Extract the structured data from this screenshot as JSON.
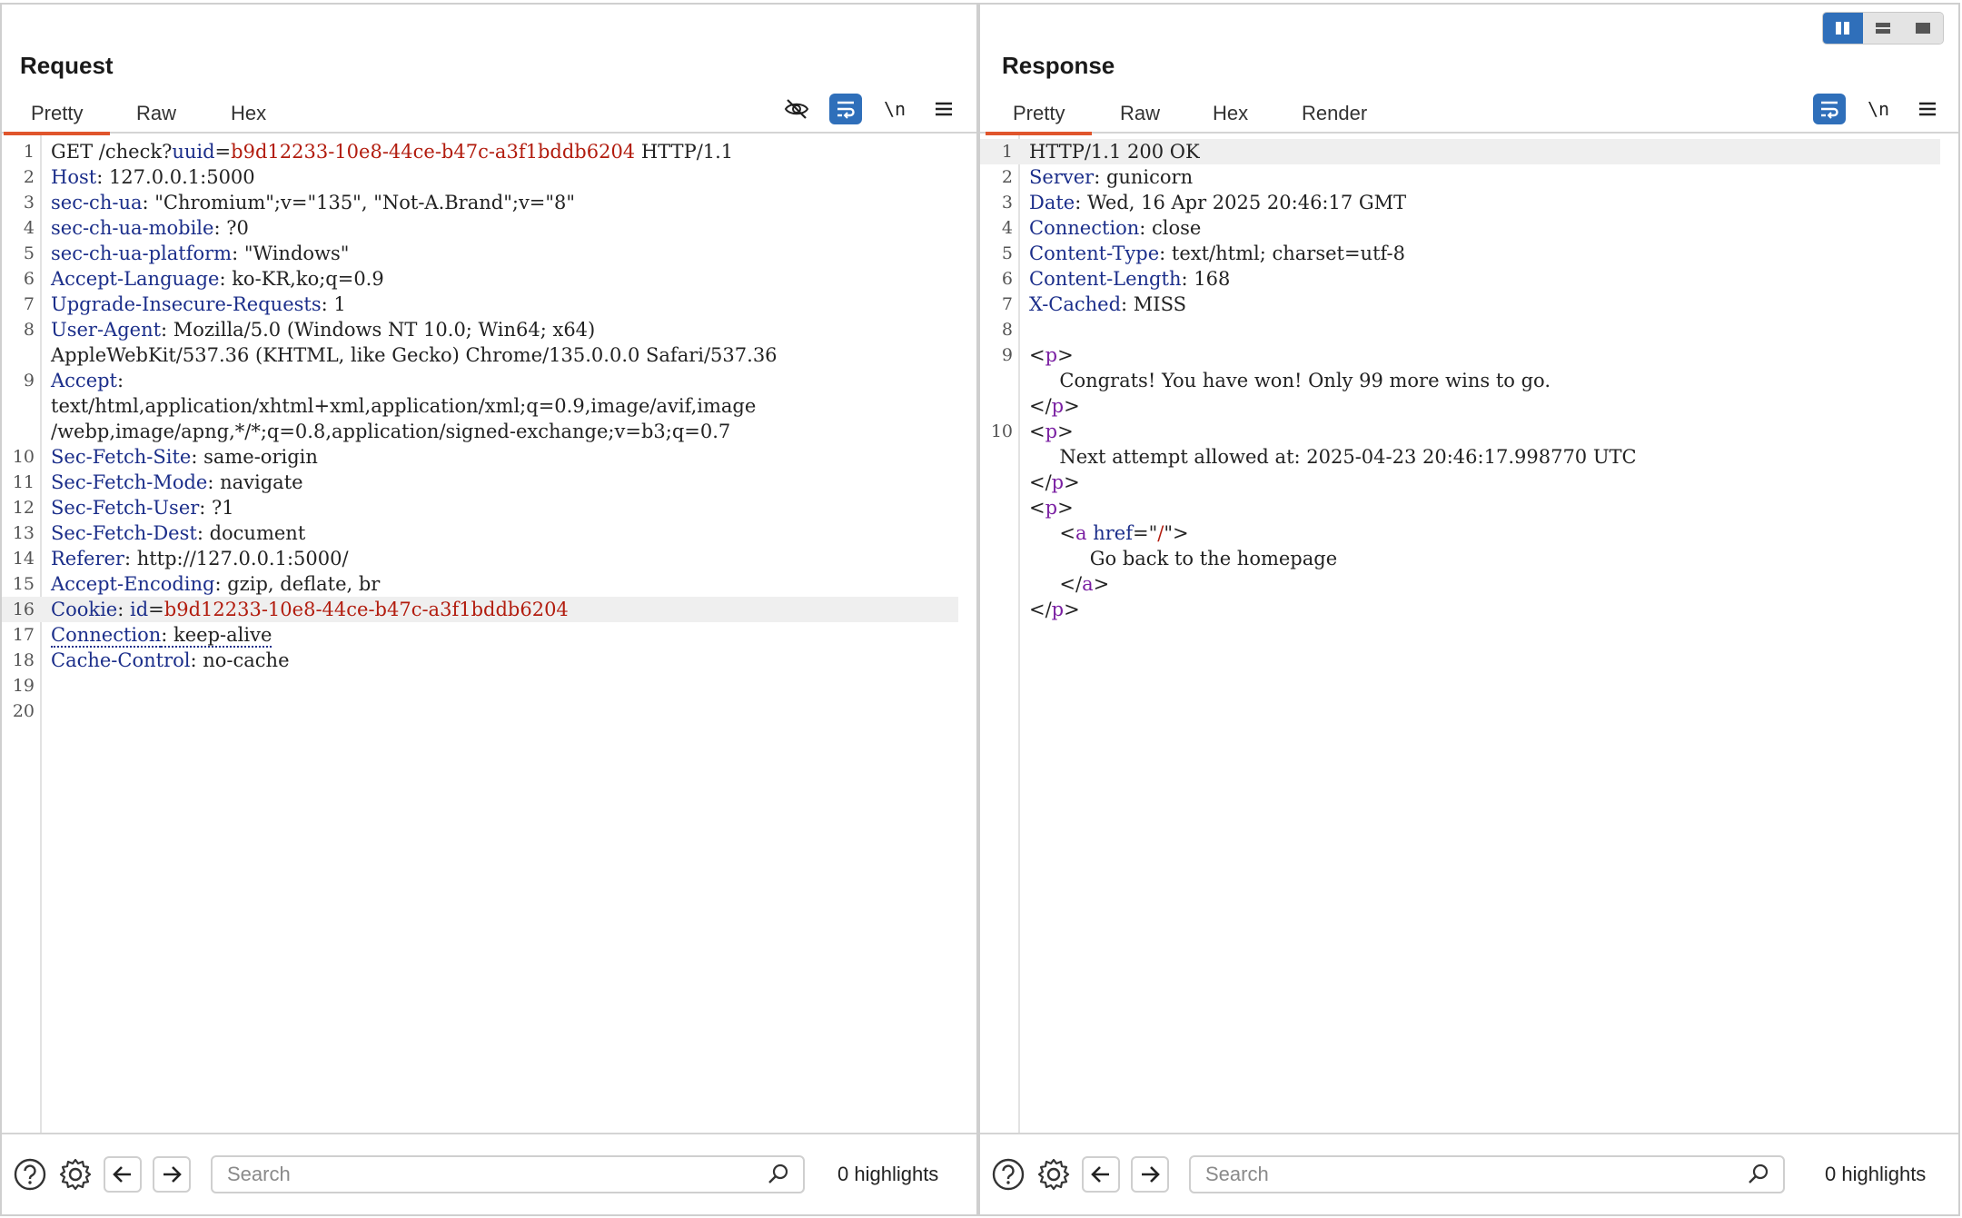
{
  "layout_toggle": [
    "side-by-side-icon",
    "stacked-icon",
    "single-icon"
  ],
  "request": {
    "title": "Request",
    "tabs": [
      "Pretty",
      "Raw",
      "Hex"
    ],
    "newline_label": "\\n",
    "lines": [
      {
        "n": "1",
        "parts": [
          [
            "v",
            "GET /check?"
          ],
          [
            "k",
            "uuid"
          ],
          [
            "v",
            "="
          ],
          [
            "r",
            "b9d12233-10e8-44ce-b47c-a3f1bddb6204"
          ],
          [
            "v",
            " HTTP/1.1"
          ]
        ]
      },
      {
        "n": "2",
        "parts": [
          [
            "k",
            "Host"
          ],
          [
            "v",
            ": 127.0.0.1:5000"
          ]
        ]
      },
      {
        "n": "3",
        "parts": [
          [
            "k",
            "sec-ch-ua"
          ],
          [
            "v",
            ": \"Chromium\";v=\"135\", \"Not-A.Brand\";v=\"8\""
          ]
        ]
      },
      {
        "n": "4",
        "parts": [
          [
            "k",
            "sec-ch-ua-mobile"
          ],
          [
            "v",
            ": ?0"
          ]
        ]
      },
      {
        "n": "5",
        "parts": [
          [
            "k",
            "sec-ch-ua-platform"
          ],
          [
            "v",
            ": \"Windows\""
          ]
        ]
      },
      {
        "n": "6",
        "parts": [
          [
            "k",
            "Accept-Language"
          ],
          [
            "v",
            ": ko-KR,ko;q=0.9"
          ]
        ]
      },
      {
        "n": "7",
        "parts": [
          [
            "k",
            "Upgrade-Insecure-Requests"
          ],
          [
            "v",
            ": 1"
          ]
        ]
      },
      {
        "n": "8",
        "parts": [
          [
            "k",
            "User-Agent"
          ],
          [
            "v",
            ": Mozilla/5.0 (Windows NT 10.0; Win64; x64)"
          ]
        ]
      },
      {
        "n": "",
        "parts": [
          [
            "v",
            "AppleWebKit/537.36 (KHTML, like Gecko) Chrome/135.0.0.0 Safari/537.36"
          ]
        ]
      },
      {
        "n": "9",
        "parts": [
          [
            "k",
            "Accept"
          ],
          [
            "v",
            ":"
          ]
        ]
      },
      {
        "n": "",
        "parts": [
          [
            "v",
            "text/html,application/xhtml+xml,application/xml;q=0.9,image/avif,image"
          ]
        ]
      },
      {
        "n": "",
        "parts": [
          [
            "v",
            "/webp,image/apng,*/*;q=0.8,application/signed-exchange;v=b3;q=0.7"
          ]
        ]
      },
      {
        "n": "10",
        "parts": [
          [
            "k",
            "Sec-Fetch-Site"
          ],
          [
            "v",
            ": same-origin"
          ]
        ]
      },
      {
        "n": "11",
        "parts": [
          [
            "k",
            "Sec-Fetch-Mode"
          ],
          [
            "v",
            ": navigate"
          ]
        ]
      },
      {
        "n": "12",
        "parts": [
          [
            "k",
            "Sec-Fetch-User"
          ],
          [
            "v",
            ": ?1"
          ]
        ]
      },
      {
        "n": "13",
        "parts": [
          [
            "k",
            "Sec-Fetch-Dest"
          ],
          [
            "v",
            ": document"
          ]
        ]
      },
      {
        "n": "14",
        "parts": [
          [
            "k",
            "Referer"
          ],
          [
            "v",
            ": http://127.0.0.1:5000/"
          ]
        ]
      },
      {
        "n": "15",
        "parts": [
          [
            "k",
            "Accept-Encoding"
          ],
          [
            "v",
            ": gzip, deflate, br"
          ]
        ]
      },
      {
        "n": "16",
        "hl": true,
        "parts": [
          [
            "k",
            "Cookie"
          ],
          [
            "v",
            ": "
          ],
          [
            "k",
            "id"
          ],
          [
            "v",
            "="
          ],
          [
            "r",
            "b9d12233-10e8-44ce-b47c-a3f1bddb6204"
          ]
        ]
      },
      {
        "n": "17",
        "parts": [
          [
            "kd",
            "Connection"
          ],
          [
            "vd",
            ": keep-alive"
          ]
        ]
      },
      {
        "n": "18",
        "parts": [
          [
            "k",
            "Cache-Control"
          ],
          [
            "v",
            ": no-cache"
          ]
        ]
      },
      {
        "n": "19",
        "parts": []
      },
      {
        "n": "20",
        "parts": []
      }
    ],
    "search_placeholder": "Search",
    "highlights": "0 highlights"
  },
  "response": {
    "title": "Response",
    "tabs": [
      "Pretty",
      "Raw",
      "Hex",
      "Render"
    ],
    "newline_label": "\\n",
    "lines": [
      {
        "n": "1",
        "hl": true,
        "parts": [
          [
            "v",
            "HTTP/1.1 200 OK"
          ]
        ]
      },
      {
        "n": "2",
        "parts": [
          [
            "k",
            "Server"
          ],
          [
            "v",
            ": gunicorn"
          ]
        ]
      },
      {
        "n": "3",
        "parts": [
          [
            "k",
            "Date"
          ],
          [
            "v",
            ": Wed, 16 Apr 2025 20:46:17 GMT"
          ]
        ]
      },
      {
        "n": "4",
        "parts": [
          [
            "k",
            "Connection"
          ],
          [
            "v",
            ": close"
          ]
        ]
      },
      {
        "n": "5",
        "parts": [
          [
            "k",
            "Content-Type"
          ],
          [
            "v",
            ": text/html; charset=utf-8"
          ]
        ]
      },
      {
        "n": "6",
        "parts": [
          [
            "k",
            "Content-Length"
          ],
          [
            "v",
            ": 168"
          ]
        ]
      },
      {
        "n": "7",
        "parts": [
          [
            "k",
            "X-Cached"
          ],
          [
            "v",
            ": MISS"
          ]
        ]
      },
      {
        "n": "8",
        "parts": []
      },
      {
        "n": "9",
        "parts": [
          [
            "v",
            "<"
          ],
          [
            "tag",
            "p"
          ],
          [
            "v",
            ">"
          ]
        ]
      },
      {
        "n": "",
        "parts": [
          [
            "v",
            "     Congrats! You have won! Only 99 more wins to go."
          ]
        ]
      },
      {
        "n": "",
        "parts": [
          [
            "v",
            "</"
          ],
          [
            "tag",
            "p"
          ],
          [
            "v",
            ">"
          ]
        ]
      },
      {
        "n": "10",
        "parts": [
          [
            "v",
            "<"
          ],
          [
            "tag",
            "p"
          ],
          [
            "v",
            ">"
          ]
        ]
      },
      {
        "n": "",
        "parts": [
          [
            "v",
            "     Next attempt allowed at: 2025-04-23 20:46:17.998770 UTC"
          ]
        ]
      },
      {
        "n": "",
        "parts": [
          [
            "v",
            "</"
          ],
          [
            "tag",
            "p"
          ],
          [
            "v",
            ">"
          ]
        ]
      },
      {
        "n": "",
        "parts": [
          [
            "v",
            "<"
          ],
          [
            "tag",
            "p"
          ],
          [
            "v",
            ">"
          ]
        ]
      },
      {
        "n": "",
        "parts": [
          [
            "v",
            "     <"
          ],
          [
            "tag",
            "a"
          ],
          [
            "v",
            " "
          ],
          [
            "k",
            "href"
          ],
          [
            "v",
            "=\""
          ],
          [
            "r",
            "/"
          ],
          [
            "v",
            "\">"
          ]
        ]
      },
      {
        "n": "",
        "parts": [
          [
            "v",
            "          Go back to the homepage"
          ]
        ]
      },
      {
        "n": "",
        "parts": [
          [
            "v",
            "     </"
          ],
          [
            "tag",
            "a"
          ],
          [
            "v",
            ">"
          ]
        ]
      },
      {
        "n": "",
        "parts": [
          [
            "v",
            "</"
          ],
          [
            "tag",
            "p"
          ],
          [
            "v",
            ">"
          ]
        ]
      }
    ],
    "search_placeholder": "Search",
    "highlights": "0 highlights"
  }
}
